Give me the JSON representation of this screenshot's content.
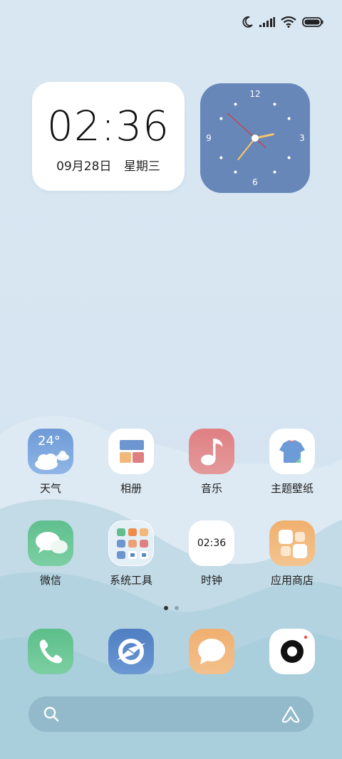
{
  "status_bar": {
    "icons": [
      "moon-icon",
      "signal-icon",
      "wifi-icon",
      "battery-icon"
    ]
  },
  "clock_widget": {
    "time": "02:36",
    "date": "09月28日",
    "weekday": "星期三"
  },
  "analog_clock": {
    "numerals": [
      "12",
      "3",
      "6",
      "9"
    ],
    "hour": 2,
    "minute": 36,
    "second": 22,
    "face_color": "#6787b8",
    "hand_color": "#f2c56b",
    "second_hand_color": "#d23a3a"
  },
  "apps": [
    {
      "label": "天气",
      "icon": "weather-icon",
      "badge": "24°"
    },
    {
      "label": "相册",
      "icon": "gallery-icon"
    },
    {
      "label": "音乐",
      "icon": "music-icon"
    },
    {
      "label": "主题壁纸",
      "icon": "theme-icon"
    },
    {
      "label": "微信",
      "icon": "wechat-icon"
    },
    {
      "label": "系统工具",
      "icon": "folder-icon"
    },
    {
      "label": "时钟",
      "icon": "clock-icon",
      "badge": "02:36"
    },
    {
      "label": "应用商店",
      "icon": "app-store-icon"
    }
  ],
  "page_indicator": {
    "pages": 2,
    "current": 1
  },
  "dock": [
    {
      "icon": "phone-icon"
    },
    {
      "icon": "browser-icon"
    },
    {
      "icon": "messages-icon"
    },
    {
      "icon": "camera-icon"
    }
  ],
  "search": {
    "icons": [
      "search-icon",
      "assistant-icon"
    ]
  }
}
